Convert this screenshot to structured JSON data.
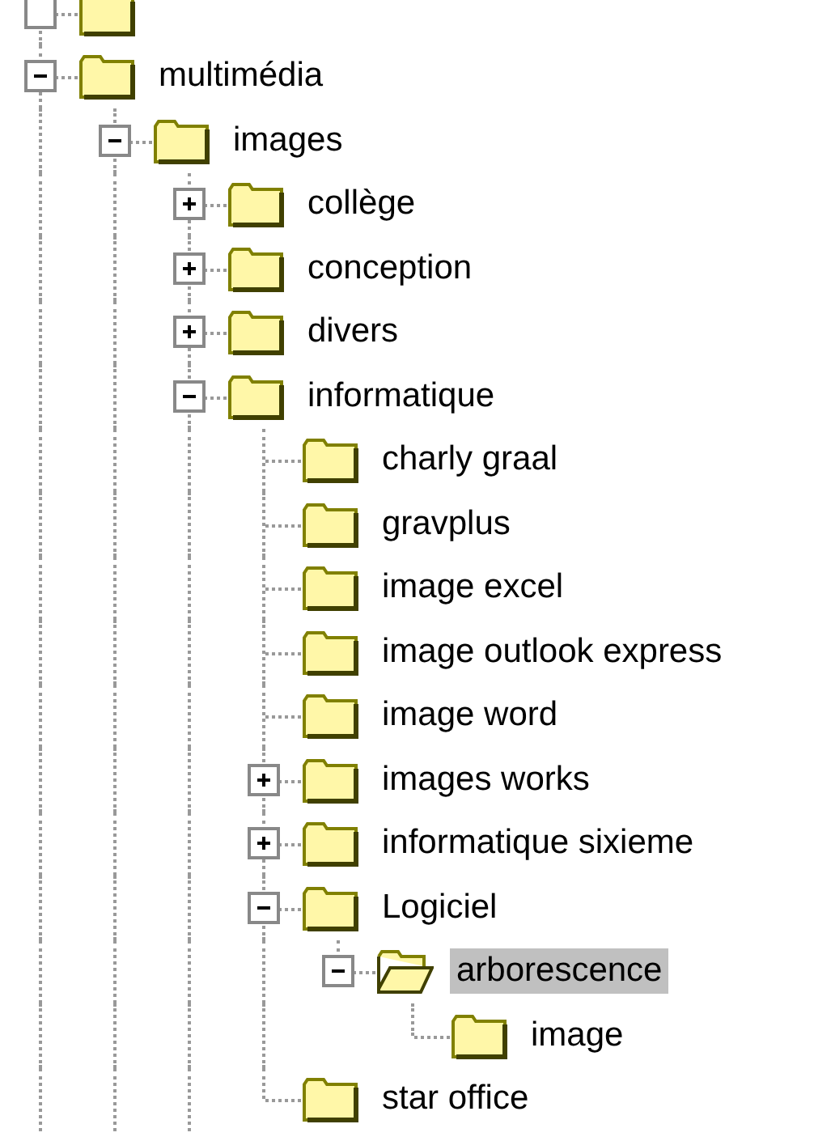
{
  "tree": {
    "items": [
      {
        "label": "multimédia",
        "expanded": true,
        "selected": false,
        "siblings_below": true,
        "children": [
          {
            "label": "images",
            "expanded": true,
            "selected": false,
            "siblings_below": true,
            "children": [
              {
                "label": "collège",
                "expanded": false,
                "selected": false
              },
              {
                "label": "conception",
                "expanded": false,
                "selected": false
              },
              {
                "label": "divers",
                "expanded": false,
                "selected": false
              },
              {
                "label": "informatique",
                "expanded": true,
                "selected": false,
                "siblings_below": true,
                "children": [
                  {
                    "label": "charly graal",
                    "selected": false
                  },
                  {
                    "label": "gravplus",
                    "selected": false
                  },
                  {
                    "label": "image excel",
                    "selected": false
                  },
                  {
                    "label": "image outlook express",
                    "selected": false
                  },
                  {
                    "label": "image word",
                    "selected": false
                  },
                  {
                    "label": "images works",
                    "expanded": false,
                    "selected": false
                  },
                  {
                    "label": "informatique sixieme",
                    "expanded": false,
                    "selected": false
                  },
                  {
                    "label": "Logiciel",
                    "expanded": true,
                    "selected": false,
                    "children": [
                      {
                        "label": "arborescence",
                        "expanded": true,
                        "selected": true,
                        "children": [
                          {
                            "label": "image",
                            "selected": false
                          }
                        ]
                      }
                    ]
                  },
                  {
                    "label": "star office",
                    "selected": false
                  }
                ]
              }
            ]
          }
        ]
      }
    ]
  }
}
